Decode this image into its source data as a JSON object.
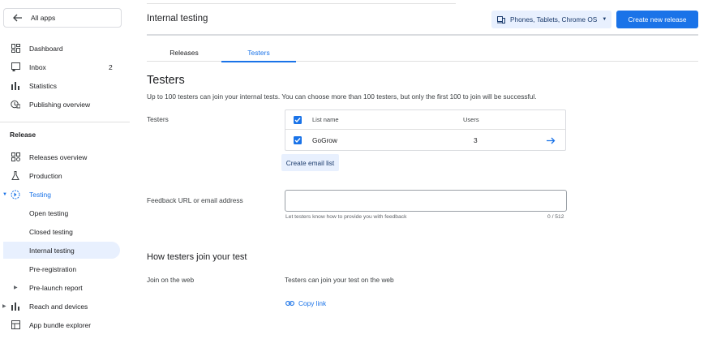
{
  "sidebar": {
    "all_apps": "All apps",
    "items": [
      {
        "label": "Dashboard"
      },
      {
        "label": "Inbox",
        "badge": "2"
      },
      {
        "label": "Statistics"
      },
      {
        "label": "Publishing overview"
      }
    ],
    "release_header": "Release",
    "release_items": [
      {
        "label": "Releases overview"
      },
      {
        "label": "Production"
      },
      {
        "label": "Testing"
      },
      {
        "label": "Open testing"
      },
      {
        "label": "Closed testing"
      },
      {
        "label": "Internal testing"
      },
      {
        "label": "Pre-registration"
      },
      {
        "label": "Pre-launch report"
      },
      {
        "label": "Reach and devices"
      },
      {
        "label": "App bundle explorer"
      }
    ]
  },
  "header": {
    "title": "Internal testing",
    "device_filter": "Phones, Tablets, Chrome OS",
    "create_button": "Create new release"
  },
  "tabs": [
    {
      "label": "Releases"
    },
    {
      "label": "Testers"
    }
  ],
  "testers": {
    "title": "Testers",
    "description": "Up to 100 testers can join your internal tests. You can choose more than 100 testers, but only the first 100 to join will be successful.",
    "field_label": "Testers",
    "table": {
      "headers": {
        "name": "List name",
        "users": "Users"
      },
      "rows": [
        {
          "name": "GoGrow",
          "users": "3"
        }
      ]
    },
    "create_email_list": "Create email list",
    "feedback_label": "Feedback URL or email address",
    "feedback_value": "",
    "feedback_hint": "Let testers know how to provide you with feedback",
    "feedback_counter": "0 / 512"
  },
  "join": {
    "title": "How testers join your test",
    "web_label": "Join on the web",
    "web_text": "Testers can join your test on the web",
    "copy_link": "Copy link"
  },
  "colors": {
    "accent": "#1a73e8",
    "selected_bg": "#e8f0fe"
  }
}
